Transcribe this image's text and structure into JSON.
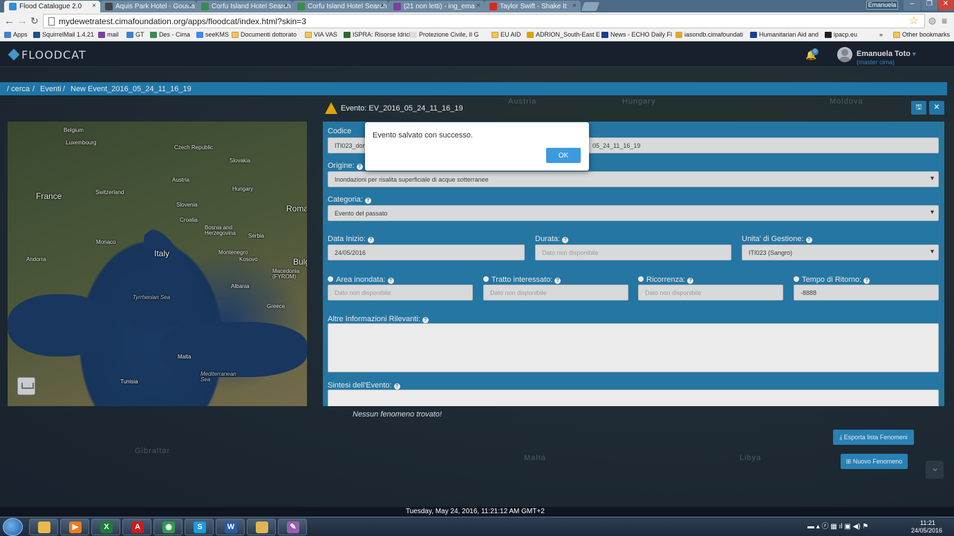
{
  "browser": {
    "tabs": [
      {
        "title": "Flood Catalogue 2.0",
        "active": true,
        "favicon_color": "#2d8fd6"
      },
      {
        "title": "Aquis Park Hotel - Gouvia",
        "active": false,
        "favicon_color": "#444444"
      },
      {
        "title": "Corfu Island Hotel Search",
        "active": false,
        "favicon_color": "#3e8a4a"
      },
      {
        "title": "Corfu Island Hotel Search",
        "active": false,
        "favicon_color": "#3e8a4a"
      },
      {
        "title": "(21 non letti) - ing_ema -",
        "active": false,
        "favicon_color": "#7b3fa0"
      },
      {
        "title": "Taylor Swift - Shake It",
        "active": false,
        "favicon_color": "#d9281f"
      }
    ],
    "close_glyph": "×",
    "profile_chip": "Emanuela",
    "url": "mydewetratest.cimafoundation.org/apps/floodcat/index.html?skin=3",
    "bookmarks": [
      {
        "label": "Apps",
        "color": "#4a7fd0"
      },
      {
        "label": "SquirrelMail 1.4.21",
        "color": "#1f4f8f"
      },
      {
        "label": "mail",
        "color": "#7b3fa0"
      },
      {
        "label": "GT",
        "color": "#3b7fd6"
      },
      {
        "label": "Des - Cima",
        "color": "#3e8a4a"
      },
      {
        "label": "seeKMS",
        "color": "#4285f4"
      },
      {
        "label": "Documenti dottorato",
        "color": "folder"
      },
      {
        "label": "VIA VAS",
        "color": "folder"
      },
      {
        "label": "ISPRA: Risorse Idriche",
        "color": "#2d6a2d"
      },
      {
        "label": "Protezione Civile, Il G",
        "color": "#dddddd"
      },
      {
        "label": "EU AID",
        "color": "folder"
      },
      {
        "label": "ADRION_South-East E",
        "color": "#e0a100"
      },
      {
        "label": "News - ECHO Daily Fl",
        "color": "#1a3d99"
      },
      {
        "label": "iasondb.cimafoundati",
        "color": "#e2a82a"
      },
      {
        "label": "Humanitarian Aid and",
        "color": "#1a3d99"
      },
      {
        "label": "ipacp.eu",
        "color": "#222222"
      },
      {
        "label": "Other bookmarks",
        "color": "folder"
      }
    ],
    "bookmarks_overflow": "»"
  },
  "app": {
    "logo_text": "FLOODCAT",
    "notification_count": "0",
    "user_name": "Emanuela Toto",
    "user_role": "(master cima)"
  },
  "breadcrumb": {
    "items": [
      "/ cerca",
      "/",
      "Eventi",
      "/",
      "New Event_2016_05_24_11_16_19"
    ]
  },
  "map": {
    "labels": [
      "Belgium",
      "Luxembourg",
      "Czech Republic",
      "Slovakia",
      "Austria",
      "Hungary",
      "France",
      "Switzerland",
      "Slovenia",
      "Croatia",
      "Bosnia and Herzegovina",
      "Serbia",
      "Roma",
      "Monaco",
      "Italy",
      "Montenegro",
      "Kosovo",
      "Bulg",
      "Andorra",
      "Macedonia (FYROM)",
      "Albania",
      "Tyrrhenian Sea",
      "Greece",
      "Malta",
      "Mediterranean Sea",
      "Tunisia"
    ]
  },
  "background_labels": [
    "Austria",
    "Hungary",
    "Moldova",
    "Romania",
    "Bosnia and Herzegovina",
    "Serbia",
    "Bulgaria",
    "Albania",
    "Gibraltar",
    "Malta",
    "Libya"
  ],
  "event": {
    "title": "Evento: EV_2016_05_24_11_16_19",
    "save_icon": "save-icon",
    "close_icon": "close-icon"
  },
  "form": {
    "codice_label": "Codice",
    "codice_value_left": "ITI023_don",
    "codice_value_right": "05_24_11_16_19",
    "origine_label": "Origine:",
    "origine_value": "Inondazioni per risalita superficiale di acque sotterranee",
    "categoria_label": "Categoria:",
    "categoria_value": "Evento del passato",
    "data_inizio_label": "Data Inizio:",
    "data_inizio_value": "24/05/2016",
    "durata_label": "Durata:",
    "durata_placeholder": "Dato non disponibile",
    "unita_label": "Unita' di Gestione:",
    "unita_value": "ITI023 (Sangro)",
    "area_label": "Area inondata:",
    "area_placeholder": "Dato non disponibile",
    "tratto_label": "Tratto interessato:",
    "tratto_placeholder": "Dato non disponibile",
    "ricorrenza_label": "Ricorrenza:",
    "ricorrenza_placeholder": "Dato non disponibile",
    "ritorno_label": "Tempo di Ritorno:",
    "ritorno_value": "-8888",
    "altre_label": "Altre Informazioni Rilevanti:",
    "sintesi_label": "Sintesi dell'Evento:",
    "help_glyph": "?"
  },
  "phenomena": {
    "empty_text": "Nessun fenomeno trovato!",
    "export_label": "⤓ Esporta lista Fenomeni",
    "new_label": "⊞ Nuovo Fenomeno"
  },
  "footer": {
    "timestamp": "Tuesday, May 24, 2016, 11:21:12 AM GMT+2"
  },
  "dialog": {
    "message": "Evento salvato con successo.",
    "ok_label": "OK"
  },
  "taskbar": {
    "apps": [
      {
        "name": "explorer-icon",
        "color": "#e8b84a",
        "glyph": ""
      },
      {
        "name": "media-player-icon",
        "color": "#f07a1a",
        "glyph": "▶"
      },
      {
        "name": "excel-icon",
        "color": "#1f7a3c",
        "glyph": "X"
      },
      {
        "name": "acrobat-icon",
        "color": "#c81d1d",
        "glyph": "A"
      },
      {
        "name": "chrome-icon",
        "color": "#2f9b4c",
        "glyph": "◉"
      },
      {
        "name": "skype-icon",
        "color": "#1a9bdc",
        "glyph": "S"
      },
      {
        "name": "word-icon",
        "color": "#2a5aa8",
        "glyph": "W"
      },
      {
        "name": "folder-icon",
        "color": "#e0b553",
        "glyph": ""
      },
      {
        "name": "paint-icon",
        "color": "#9a5db0",
        "glyph": "✎"
      }
    ],
    "tray_glyphs": "▬ ▴ ⓡ ▦ ıl ▣ ◀) ⚑",
    "clock_time": "11:21",
    "clock_date": "24/05/2016"
  }
}
